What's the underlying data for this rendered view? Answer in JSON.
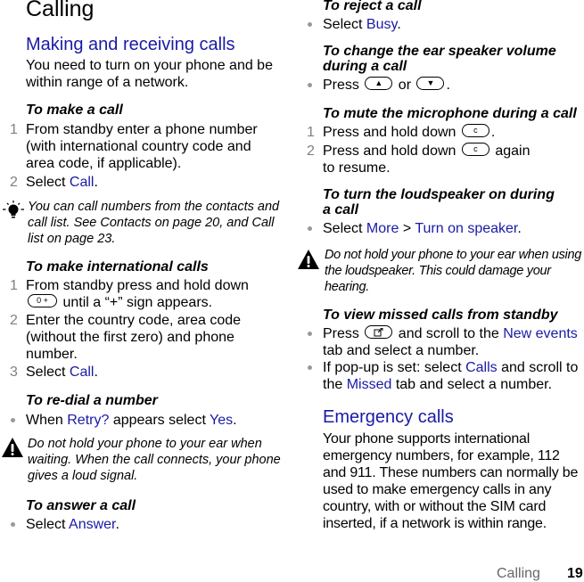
{
  "page": {
    "title": "Calling",
    "footer_section": "Calling",
    "footer_page_number": "19"
  },
  "left": {
    "section_title": "Making and receiving calls",
    "intro": "You need to turn on your phone and be within range of a network.",
    "make_call": {
      "heading": "To make a call",
      "step1_num": "1",
      "step1": "From standby enter a phone number (with international country code and area code, if applicable).",
      "step2_num": "2",
      "step2_prefix": "Select ",
      "step2_link": "Call",
      "step2_suffix": "."
    },
    "tip": {
      "icon": "lightbulb-icon",
      "text": "You can call numbers from the contacts and call list. See Contacts on page 20, and Call list on page 23."
    },
    "international": {
      "heading": "To make international calls",
      "step1_num": "1",
      "step1_prefix": "From standby press and hold down",
      "step1_key": "0 +",
      "step1_suffix": " until a “+” sign appears.",
      "step2_num": "2",
      "step2": "Enter the country code, area code (without the first zero) and phone number.",
      "step3_num": "3",
      "step3_prefix": "Select ",
      "step3_link": "Call",
      "step3_suffix": "."
    },
    "redial": {
      "heading": "To re-dial a number",
      "bullet_prefix": "When ",
      "bullet_link1": "Retry?",
      "bullet_middle": " appears select ",
      "bullet_link2": "Yes",
      "bullet_suffix": "."
    },
    "warning": {
      "icon": "warning-icon",
      "text": "Do not hold your phone to your ear when waiting. When the call connects, your phone gives a loud signal."
    },
    "answer": {
      "heading": "To answer a call",
      "bullet_prefix": "Select ",
      "bullet_link": "Answer",
      "bullet_suffix": "."
    }
  },
  "right": {
    "reject": {
      "heading": "To reject a call",
      "bullet_prefix": "Select ",
      "bullet_link": "Busy",
      "bullet_suffix": "."
    },
    "volume": {
      "heading": "To change the ear speaker volume during a call",
      "bullet_prefix": "Press ",
      "key_up": "▲",
      "bullet_middle": " or ",
      "key_down": "▼",
      "bullet_suffix": "."
    },
    "mute": {
      "heading": "To mute the microphone during a call",
      "step1_num": "1",
      "step1_prefix": "Press and hold down ",
      "step1_key": "c",
      "step1_suffix": ".",
      "step2_num": "2",
      "step2_prefix": "Press and hold down ",
      "step2_key": "c",
      "step2_suffix": " again",
      "step2_line2": "to resume."
    },
    "loudspeaker": {
      "heading": "To turn the loudspeaker on during a call",
      "bullet_prefix": "Select ",
      "bullet_link1": "More",
      "bullet_sep": " > ",
      "bullet_link2": "Turn on speaker",
      "bullet_suffix": "."
    },
    "warning": {
      "icon": "warning-icon",
      "text": "Do not hold your phone to your ear when using the loudspeaker. This could damage your hearing."
    },
    "missed": {
      "heading": "To view missed calls from standby",
      "bullet1_prefix": "Press ",
      "bullet1_key": "activity-menu-key",
      "bullet1_middle": " and scroll to the ",
      "bullet1_link": "New events",
      "bullet1_suffix": " tab and select a number.",
      "bullet2_prefix": "If pop-up is set: select ",
      "bullet2_link1": "Calls",
      "bullet2_middle": " and scroll to the ",
      "bullet2_link2": "Missed",
      "bullet2_suffix": " tab and select a number."
    },
    "emergency": {
      "section_title": "Emergency calls",
      "text": "Your phone supports international emergency numbers, for example, 112 and 911. These numbers can normally be used to make emergency calls in any country, with or without the SIM card inserted, if a network is within range."
    }
  },
  "colors": {
    "link": "#1a1aa6",
    "section_title": "#1a1aa6",
    "step_number": "#808080",
    "bullet": "#999999",
    "footer_section": "#666666"
  }
}
